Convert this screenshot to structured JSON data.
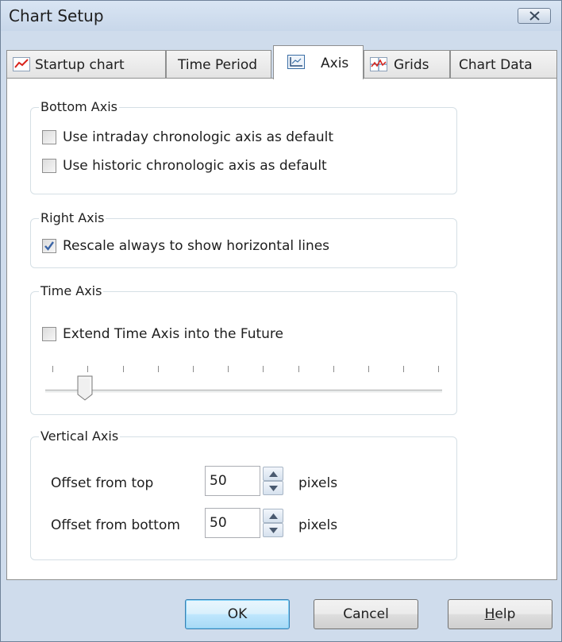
{
  "window": {
    "title": "Chart Setup"
  },
  "tabs": [
    {
      "label": "Startup chart",
      "icon": "line-chart-icon",
      "active": false
    },
    {
      "label": "Time Period",
      "active": false
    },
    {
      "label": "Axis",
      "icon": "axis-icon",
      "active": true
    },
    {
      "label": "Grids",
      "icon": "grid-chart-icon",
      "active": false
    },
    {
      "label": "Chart Data",
      "active": false
    }
  ],
  "bottom_axis": {
    "title": "Bottom Axis",
    "intraday_label": "Use intraday chronologic axis as default",
    "intraday_checked": false,
    "historic_label": "Use historic chronologic axis as default",
    "historic_checked": false
  },
  "right_axis": {
    "title": "Right Axis",
    "rescale_label": "Rescale always to show horizontal lines",
    "rescale_checked": true
  },
  "time_axis": {
    "title": "Time Axis",
    "extend_label": "Extend Time Axis into the Future",
    "extend_checked": false,
    "slider": {
      "ticks": 12,
      "position": 1
    }
  },
  "vertical_axis": {
    "title": "Vertical Axis",
    "offset_top_label": "Offset from top",
    "offset_top_value": "50",
    "offset_bottom_label": "Offset from bottom",
    "offset_bottom_value": "50",
    "unit": "pixels"
  },
  "buttons": {
    "ok": "OK",
    "cancel": "Cancel",
    "help_mnemonic": "H",
    "help_rest": "elp"
  },
  "colors": {
    "accent": "#3c7fb1",
    "window_frame": "#cfdcec"
  }
}
